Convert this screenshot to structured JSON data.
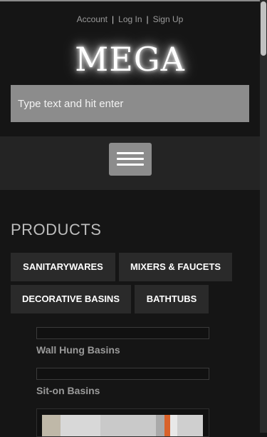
{
  "header": {
    "links": {
      "account": "Account",
      "login": "Log In",
      "signup": "Sign Up",
      "separator": "|"
    },
    "logo": "MEGA"
  },
  "search": {
    "placeholder": "Type text and hit enter"
  },
  "nav": {
    "menu_icon": "hamburger-menu-icon"
  },
  "products": {
    "title": "PRODUCTS",
    "categories": [
      "SANITARYWARES",
      "MIXERS & FAUCETS",
      "DECORATIVE BASINS",
      "BATHTUBS"
    ],
    "items": [
      "Wall Hung Basins",
      "Sit-on Basins"
    ]
  },
  "colors": {
    "background": "#151515",
    "band": "#242424",
    "button": "#2a2a2a",
    "search": "#8c8c8c"
  }
}
